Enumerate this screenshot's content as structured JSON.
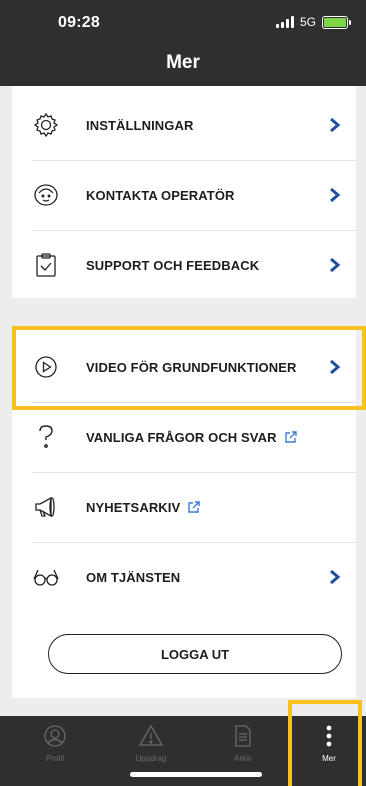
{
  "status_bar": {
    "time": "09:28",
    "network": "5G"
  },
  "header": {
    "title": "Mer"
  },
  "menu_group_1": [
    {
      "label": "INSTÄLLNINGAR",
      "icon": "gear-icon",
      "trailing": "chevron"
    },
    {
      "label": "KONTAKTA OPERATÖR",
      "icon": "operator-face-icon",
      "trailing": "chevron"
    },
    {
      "label": "SUPPORT OCH FEEDBACK",
      "icon": "clipboard-check-icon",
      "trailing": "chevron"
    }
  ],
  "menu_group_2": [
    {
      "label": "VIDEO FÖR GRUNDFUNKTIONER",
      "icon": "play-circle-icon",
      "trailing": "chevron"
    },
    {
      "label": "VANLIGA FRÅGOR OCH SVAR",
      "icon": "question-icon",
      "trailing": "external-link"
    },
    {
      "label": "NYHETSARKIV",
      "icon": "megaphone-icon",
      "trailing": "external-link"
    },
    {
      "label": "OM TJÄNSTEN",
      "icon": "glasses-icon",
      "trailing": "chevron"
    }
  ],
  "logout_label": "LOGGA UT",
  "tabs": [
    {
      "label": "Profil",
      "icon": "profile-icon",
      "active": false
    },
    {
      "label": "Uppdrag",
      "icon": "warning-icon",
      "active": false
    },
    {
      "label": "Arkiv",
      "icon": "document-icon",
      "active": false
    },
    {
      "label": "Mer",
      "icon": "more-dots-icon",
      "active": true
    }
  ],
  "colors": {
    "accent": "#1f4fa0",
    "highlight": "#f8c21c",
    "bar": "#2f2f2f",
    "external_link": "#3a7bd5",
    "battery": "#7dd54a"
  }
}
